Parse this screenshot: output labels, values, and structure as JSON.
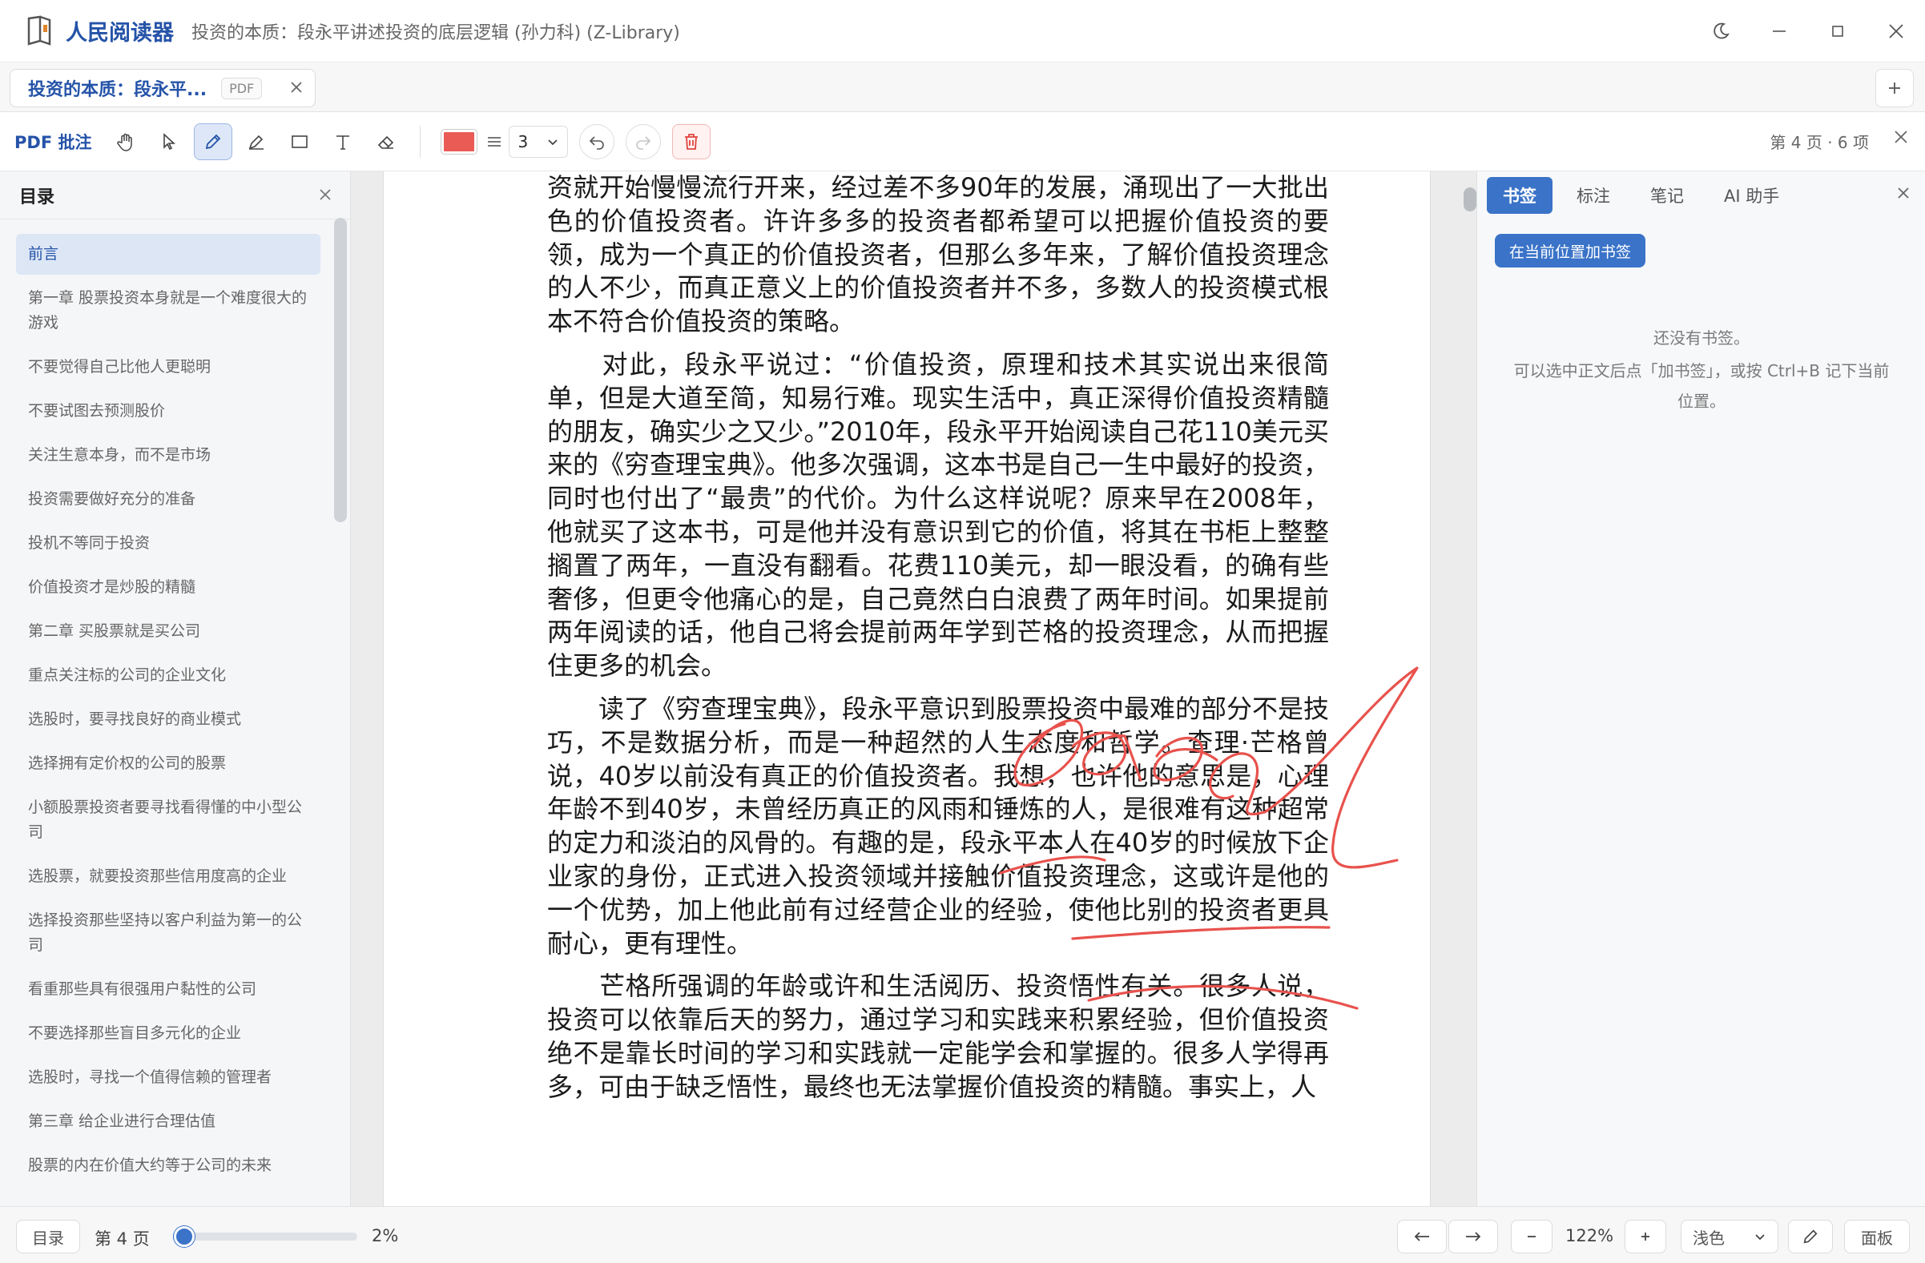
{
  "app": {
    "name": "人民阅读器",
    "window_title": "投资的本质：段永平讲述投资的底层逻辑 (孙力科) (Z-Library)"
  },
  "tab": {
    "title": "投资的本质：段永平...",
    "badge": "PDF"
  },
  "toolbar": {
    "label": "PDF 批注",
    "stroke_color": "#ea5b56",
    "stroke_width": "3",
    "status": "第 4 页 · 6 项",
    "tools": [
      "hand-icon",
      "pointer-icon",
      "pen-icon",
      "highlighter-icon",
      "rectangle-icon",
      "text-icon",
      "eraser-icon"
    ],
    "active_tool": "pen-icon"
  },
  "toc": {
    "title": "目录",
    "items": [
      "前言",
      "第一章 股票投资本身就是一个难度很大的游戏",
      "不要觉得自己比他人更聪明",
      "不要试图去预测股价",
      "关注生意本身，而不是市场",
      "投资需要做好充分的准备",
      "投机不等同于投资",
      "价值投资才是炒股的精髓",
      "第二章 买股票就是买公司",
      "重点关注标的公司的企业文化",
      "选股时，要寻找良好的商业模式",
      "选择拥有定价权的公司的股票",
      "小额股票投资者要寻找看得懂的中小型公司",
      "选股票，就要投资那些信用度高的企业",
      "选择投资那些坚持以客户利益为第一的公司",
      "看重那些具有很强用户黏性的公司",
      "不要选择那些盲目多元化的企业",
      "选股时，寻找一个值得信赖的管理者",
      "第三章 给企业进行合理估值",
      "股票的内在价值大约等于公司的未来"
    ]
  },
  "page": {
    "paragraphs": [
      "资就开始慢慢流行开来，经过差不多90年的发展，涌现出了一大批出色的价值投资者。许许多多的投资者都希望可以把握价值投资的要领，成为一个真正的价值投资者，但那么多年来，了解价值投资理念的人不少，而真正意义上的价值投资者并不多，多数人的投资模式根本不符合价值投资的策略。",
      "　　对此，段永平说过：“价值投资，原理和技术其实说出来很简单，但是大道至简，知易行难。现实生活中，真正深得价值投资精髓的朋友，确实少之又少。”2010年，段永平开始阅读自己花110美元买来的《穷查理宝典》。他多次强调，这本书是自己一生中最好的投资，同时也付出了“最贵”的代价。为什么这样说呢？原来早在2008年，他就买了这本书，可是他并没有意识到它的价值，将其在书柜上整整搁置了两年，一直没有翻看。花费110美元，却一眼没看，的确有些奢侈，但更令他痛心的是，自己竟然白白浪费了两年时间。如果提前两年阅读的话，他自己将会提前两年学到芒格的投资理念，从而把握住更多的机会。",
      "　　读了《穷查理宝典》，段永平意识到股票投资中最难的部分不是技巧，不是数据分析，而是一种超然的人生态度和哲学。查理·芒格曾说，40岁以前没有真正的价值投资者。我想，也许他的意思是，心理年龄不到40岁，未曾经历真正的风雨和锤炼的人，是很难有这种超常的定力和淡泊的风骨的。有趣的是，段永平本人在40岁的时候放下企业家的身份，正式进入投资领域并接触价值投资理念，这或许是他的一个优势，加上他此前有过经营企业的经验，使他比别的投资者更具耐心，更有理性。",
      "　　芒格所强调的年龄或许和生活阅历、投资悟性有关。很多人说，投资可以依靠后天的努力，通过学习和实践来积累经验，但价值投资绝不是靠长时间的学习和实践就一定能学会和掌握的。很多人学得再多，可由于缺乏悟性，最终也无法掌握价值投资的精髓。事实上，人"
    ],
    "ink_color": "#e8524d"
  },
  "side_panel": {
    "tabs": [
      "书签",
      "标注",
      "笔记",
      "AI 助手"
    ],
    "active_tab": "书签",
    "add_button": "在当前位置加书签",
    "empty_line1": "还没有书签。",
    "empty_line2": "可以选中正文后点「加书签」，或按 Ctrl+B 记下当前位置。"
  },
  "status": {
    "toc_button": "目录",
    "page_label": "第 4 页",
    "progress": 0.02,
    "progress_text": "2%",
    "zoom": "122%",
    "theme": "浅色",
    "panel_button": "面板"
  }
}
